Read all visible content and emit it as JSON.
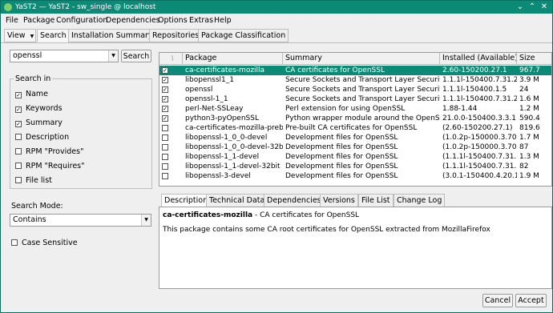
{
  "window": {
    "title": "YaST2 — YaST2 - sw_single @ localhost",
    "minimize": "⌄",
    "maximize": "⌃",
    "close": "✕"
  },
  "menubar": [
    "File",
    "Package",
    "Configuration",
    "Dependencies",
    "Options",
    "Extras",
    "Help"
  ],
  "toolbar": {
    "view_label": "View",
    "tabs": [
      "Search",
      "Installation Summary",
      "Repositories",
      "Package Classification"
    ]
  },
  "search": {
    "value": "openssl",
    "button": "Search"
  },
  "search_in": {
    "title": "Search in",
    "options": [
      {
        "label": "Name",
        "checked": true
      },
      {
        "label": "Keywords",
        "checked": true
      },
      {
        "label": "Summary",
        "checked": true
      },
      {
        "label": "Description",
        "checked": false
      },
      {
        "label": "RPM \"Provides\"",
        "checked": false
      },
      {
        "label": "RPM \"Requires\"",
        "checked": false
      },
      {
        "label": "File list",
        "checked": false
      }
    ]
  },
  "search_mode": {
    "label": "Search Mode:",
    "value": "Contains"
  },
  "case_sensitive": {
    "label": "Case Sensitive",
    "checked": false
  },
  "table": {
    "headers": [
      "",
      "Package",
      "Summary",
      "Installed (Available)",
      "Size"
    ],
    "rows": [
      {
        "checked": true,
        "package": "ca-certificates-mozilla",
        "summary": "CA certificates for OpenSSL",
        "installed": "2.60-150200.27.1",
        "size": "967.7",
        "selected": true
      },
      {
        "checked": true,
        "package": "libopenssl1_1",
        "summary": "Secure Sockets and Transport Layer Security",
        "installed": "1.1.1l-150400.7.31.2",
        "size": "3.9 M"
      },
      {
        "checked": true,
        "package": "openssl",
        "summary": "Secure Sockets and Transport Layer Security",
        "installed": "1.1.1l-150400.1.5",
        "size": "24"
      },
      {
        "checked": true,
        "package": "openssl-1_1",
        "summary": "Secure Sockets and Transport Layer Security",
        "installed": "1.1.1l-150400.7.31.2",
        "size": "1.6 M"
      },
      {
        "checked": true,
        "package": "perl-Net-SSLeay",
        "summary": "Perl extension for using OpenSSL",
        "installed": "1.88-1.44",
        "size": "1.2 M"
      },
      {
        "checked": true,
        "package": "python3-pyOpenSSL",
        "summary": "Python wrapper module around the OpenSSL...",
        "installed": "21.0.0-150400.3.3.1",
        "size": "590.4"
      },
      {
        "checked": false,
        "package": "ca-certificates-mozilla-prebu...",
        "summary": "Pre-built CA certificates for OpenSSL",
        "installed": "(2.60-150200.27.1)",
        "size": "819.6"
      },
      {
        "checked": false,
        "package": "libopenssl-1_0_0-devel",
        "summary": "Development files for OpenSSL",
        "installed": "(1.0.2p-150000.3.70.1)",
        "size": "1.7 M"
      },
      {
        "checked": false,
        "package": "libopenssl-1_0_0-devel-32bit",
        "summary": "Development files for OpenSSL",
        "installed": "(1.0.2p-150000.3.70.1)",
        "size": "87"
      },
      {
        "checked": false,
        "package": "libopenssl-1_1-devel",
        "summary": "Development files for OpenSSL",
        "installed": "(1.1.1l-150400.7.31.2)",
        "size": "1.3 M"
      },
      {
        "checked": false,
        "package": "libopenssl-1_1-devel-32bit",
        "summary": "Development files for OpenSSL",
        "installed": "(1.1.1l-150400.7.31.2)",
        "size": "82"
      },
      {
        "checked": false,
        "package": "libopenssl-3-devel",
        "summary": "Development files for OpenSSL",
        "installed": "(3.0.1-150400.4.20.1)",
        "size": "1.9 M"
      }
    ]
  },
  "detail_tabs": [
    "Description",
    "Technical Data",
    "Dependencies",
    "Versions",
    "File List",
    "Change Log"
  ],
  "description": {
    "name": "ca-certificates-mozilla",
    "short": " - CA certificates for OpenSSL",
    "body": "This package contains some CA root certificates for OpenSSL extracted from MozillaFirefox"
  },
  "buttons": {
    "cancel": "Cancel",
    "accept": "Accept"
  },
  "colors": {
    "title_bar": "#0b8a78",
    "selection": "#0b8a78"
  }
}
